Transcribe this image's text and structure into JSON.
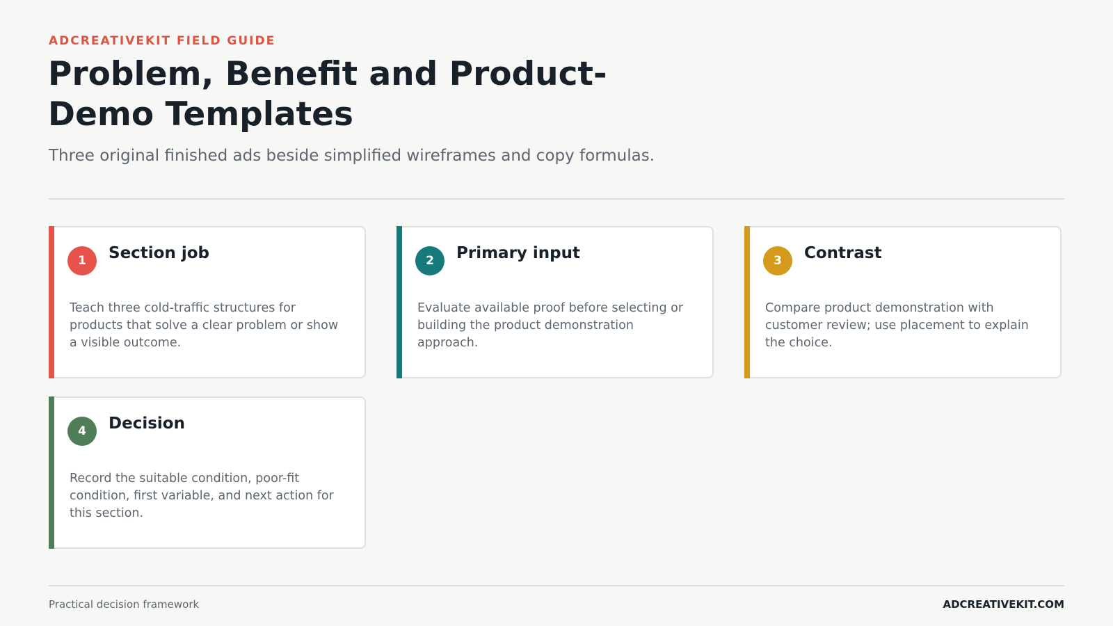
{
  "header": {
    "eyebrow": "ADCREATIVEKIT FIELD GUIDE",
    "title": "Problem, Benefit and Product-Demo Templates",
    "subtitle": "Three original finished ads beside simplified wireframes and copy formulas."
  },
  "cards": [
    {
      "number": "1",
      "title": "Section job",
      "body": "Teach three cold-traffic structures for products that solve a clear problem or show a visible outcome.",
      "color": "#e5534b"
    },
    {
      "number": "2",
      "title": "Primary input",
      "body": "Evaluate available proof before selecting or building the product demonstration approach.",
      "color": "#177a7a"
    },
    {
      "number": "3",
      "title": "Contrast",
      "body": "Compare product demonstration with customer review; use placement to explain the choice.",
      "color": "#d49a1e"
    },
    {
      "number": "4",
      "title": "Decision",
      "body": "Record the suitable condition, poor-fit condition, first variable, and next action for this section.",
      "color": "#4f7d57"
    }
  ],
  "footer": {
    "left": "Practical decision framework",
    "right": "ADCREATIVEKIT.COM"
  }
}
